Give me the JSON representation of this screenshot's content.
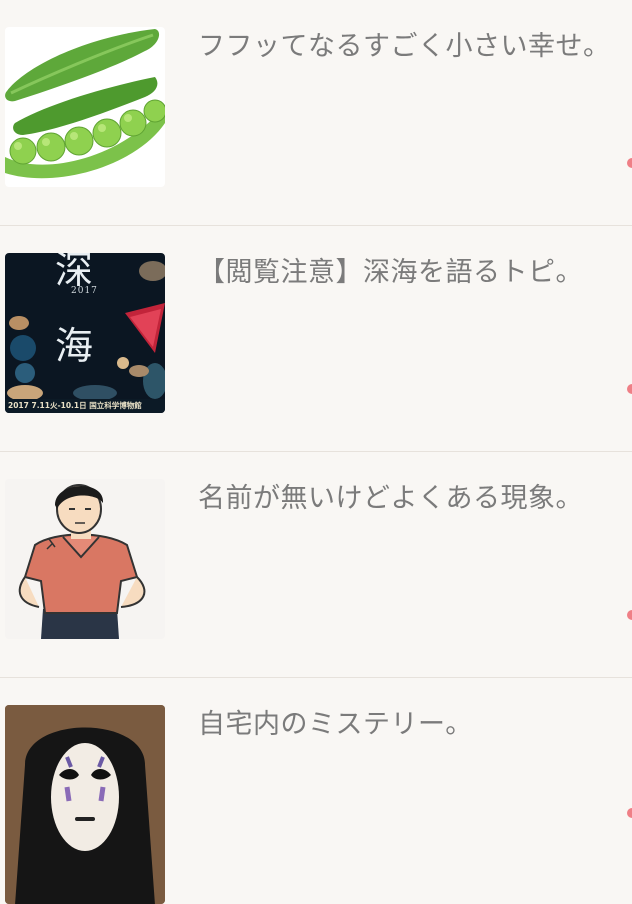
{
  "topics": [
    {
      "title": "フフッてなるすごく小さい幸せ。",
      "thumbnail_icon": "green-peas-image"
    },
    {
      "title": "【閲覧注意】深海を語るトピ。",
      "thumbnail_icon": "deep-sea-poster-image",
      "poster": {
        "kanji_top": "深",
        "kanji_main": "海",
        "year": "2017",
        "footer": "2017 7.11火-10.1日 国立科学博物館"
      }
    },
    {
      "title": "名前が無いけどよくある現象。",
      "thumbnail_icon": "man-illustration-image"
    },
    {
      "title": "自宅内のミステリー。",
      "thumbnail_icon": "no-face-image"
    }
  ],
  "colors": {
    "background": "#f9f7f4",
    "title_text": "#7b7b7b",
    "divider": "#e7e2dc",
    "unread_dot": "#ef7f86"
  }
}
